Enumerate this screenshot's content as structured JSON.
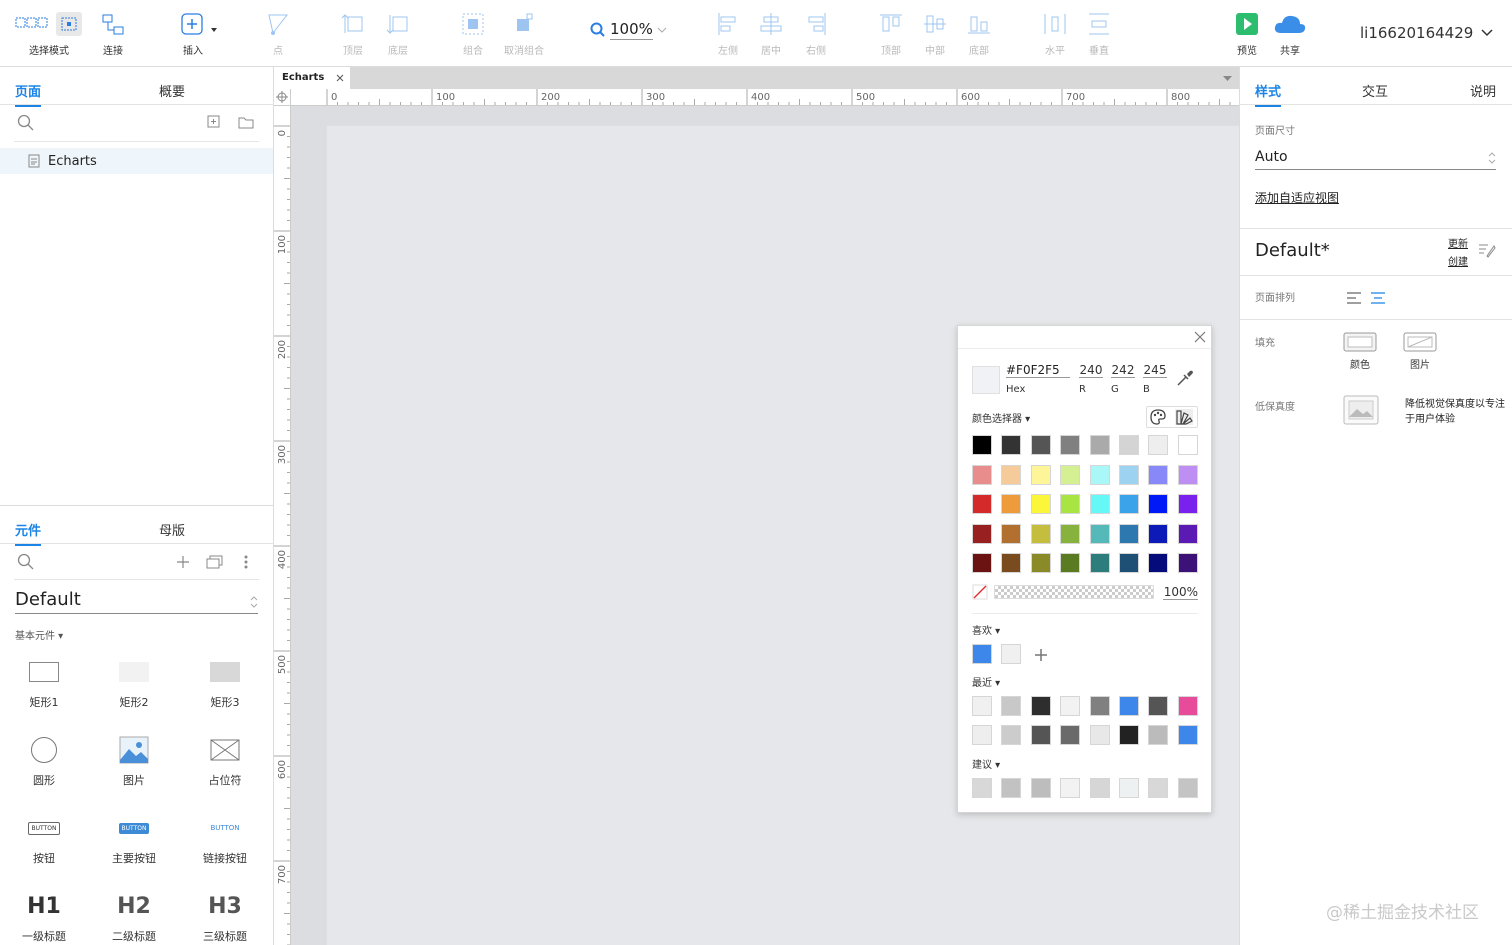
{
  "toolbar": {
    "select_mode": "选择模式",
    "connect": "连接",
    "insert": "插入",
    "point": "点",
    "top_layer": "顶层",
    "bottom_layer": "底层",
    "group": "组合",
    "ungroup": "取消组合",
    "zoom": "100%",
    "align_left": "左侧",
    "align_center": "居中",
    "align_right": "右侧",
    "align_top": "顶部",
    "align_middle": "中部",
    "align_bottom": "底部",
    "distribute_h": "水平",
    "distribute_v": "垂直",
    "preview": "预览",
    "share": "共享",
    "username": "li16620164429"
  },
  "pages_panel": {
    "tab_pages": "页面",
    "tab_outline": "概要",
    "page_name": "Echarts"
  },
  "library_panel": {
    "tab_widgets": "元件",
    "tab_masters": "母版",
    "library_name": "Default",
    "section": "基本元件",
    "items": [
      {
        "label": "矩形1"
      },
      {
        "label": "矩形2"
      },
      {
        "label": "矩形3"
      },
      {
        "label": "圆形"
      },
      {
        "label": "图片"
      },
      {
        "label": "占位符"
      },
      {
        "label": "按钮",
        "inner": "BUTTON"
      },
      {
        "label": "主要按钮",
        "inner": "BUTTON"
      },
      {
        "label": "链接按钮",
        "inner": "BUTTON"
      },
      {
        "label": "一级标题",
        "inner": "H1"
      },
      {
        "label": "二级标题",
        "inner": "H2"
      },
      {
        "label": "三级标题",
        "inner": "H3"
      }
    ]
  },
  "canvas": {
    "doc_tab": "Echarts",
    "ruler_x": [
      "0",
      "100",
      "200",
      "300",
      "400",
      "500",
      "600",
      "700",
      "800"
    ],
    "ruler_y": [
      "0",
      "100",
      "200",
      "300",
      "400",
      "500",
      "600",
      "700"
    ]
  },
  "style_panel": {
    "tab_style": "样式",
    "tab_interact": "交互",
    "tab_notes": "说明",
    "page_size_label": "页面尺寸",
    "page_size_value": "Auto",
    "add_adaptive": "添加自适应视图",
    "style_name": "Default*",
    "update": "更新",
    "create": "创建",
    "page_align": "页面排列",
    "fill_label": "填充",
    "fill_color": "颜色",
    "fill_image": "图片",
    "low_fidelity": "低保真度",
    "low_fidelity_desc": "降低视觉保真度以专注于用户体验"
  },
  "color_picker": {
    "hex": "#F0F2F5",
    "hex_label": "Hex",
    "r": "240",
    "g": "242",
    "b": "245",
    "r_label": "R",
    "g_label": "G",
    "b_label": "B",
    "picker_label": "颜色选择器",
    "opacity": "100%",
    "favorites_label": "喜欢",
    "recent_label": "最近",
    "suggest_label": "建议",
    "grid": [
      [
        "#000000",
        "#333333",
        "#555555",
        "#808080",
        "#aaaaaa",
        "#d4d4d4",
        "#eeeeee",
        "#ffffff"
      ],
      [
        "#e88c8c",
        "#f5cc99",
        "#fdf598",
        "#d5ef93",
        "#a9f7f7",
        "#9dd3f1",
        "#8888f9",
        "#bf8ef3"
      ],
      [
        "#d42a2a",
        "#ee9b3c",
        "#fbf63a",
        "#a9e542",
        "#66f7f7",
        "#3aa3ea",
        "#0019f6",
        "#7a21ee"
      ],
      [
        "#982020",
        "#b1702f",
        "#c4bd3e",
        "#88b23e",
        "#55b8b9",
        "#2e78b0",
        "#0d1ab7",
        "#5b1ab3"
      ],
      [
        "#6b1313",
        "#7a4b1e",
        "#8a8a28",
        "#5a7b21",
        "#2e7d7d",
        "#1d5074",
        "#050b7a",
        "#3c1279"
      ]
    ],
    "favorites": [
      "#3d86ea",
      "#f0f0f0"
    ],
    "recent_row1": [
      "#f0f0f0",
      "#c8c8c8",
      "#2e2e2e",
      "#f2f2f2",
      "#808080",
      "#3d86ea",
      "#555555",
      "#e94b9b"
    ],
    "recent_row2": [
      "#eeeeee",
      "#cccccc",
      "#555555",
      "#6a6a6a",
      "#e8e8e8",
      "#222222",
      "#bbbbbb",
      "#3d86ea"
    ],
    "suggest": [
      "#d8d8d8",
      "#c2c2c2",
      "#bdbdbd",
      "#f2f2f2",
      "#d6d6d6",
      "#eef1f1",
      "#d8d8d8",
      "#c4c4c4"
    ]
  },
  "watermark": "@稀土掘金技术社区"
}
